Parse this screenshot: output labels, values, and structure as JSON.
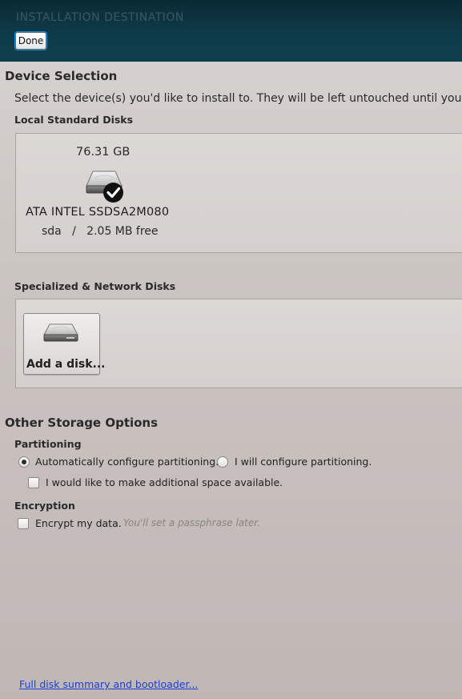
{
  "header": {
    "title": "INSTALLATION DESTINATION",
    "done_label": "Done"
  },
  "device_selection": {
    "title": "Device Selection",
    "description": "Select the device(s) you'd like to install to.  They will be left untouched until you",
    "local_disks_title": "Local Standard Disks",
    "disks": [
      {
        "size": "76.31 GB",
        "name": "ATA INTEL SSDSA2M080",
        "info": "sda   /   2.05 MB free",
        "selected": true
      }
    ],
    "specialized_title": "Specialized & Network Disks",
    "add_disk_label": "Add a disk..."
  },
  "other_storage": {
    "title": "Other Storage Options",
    "partitioning_title": "Partitioning",
    "auto_label": "Automatically configure partitioning.",
    "manual_label": "I will configure partitioning.",
    "additional_space_label": "I would like to make additional space available.",
    "encryption_title": "Encryption",
    "encrypt_label": "Encrypt my data.",
    "encrypt_hint": "You'll set a passphrase later."
  },
  "footer": {
    "summary_link": "Full disk summary and bootloader..."
  }
}
